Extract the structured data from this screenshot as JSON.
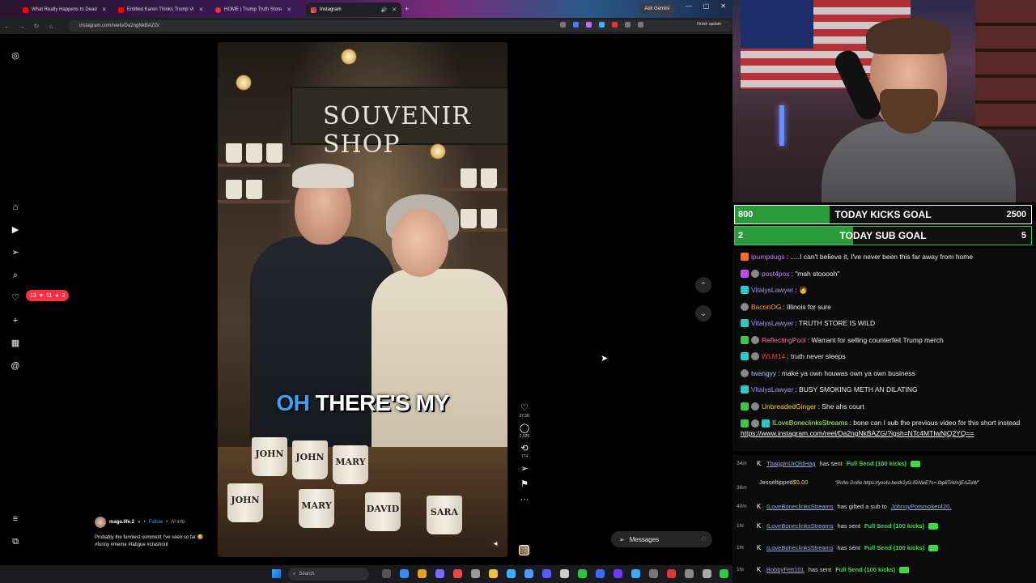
{
  "browser": {
    "tabs": [
      {
        "label": "What Really Happens to Dead",
        "icon": "youtube"
      },
      {
        "label": "Entitled Karen Thinks Trump Vi",
        "icon": "youtube"
      },
      {
        "label": "HOME | Trump Truth Store",
        "icon": "site"
      },
      {
        "label": "Instagram",
        "icon": "instagram"
      }
    ],
    "gemini_label": "Ask Gemini",
    "url": "instagram.com/reels/Da2ngNkBAZG/",
    "finish_update": "Finish update"
  },
  "reel": {
    "sign": "SOUVENIR SHOP",
    "caption_highlight": "OH",
    "caption_rest": " THERE'S MY",
    "mugs": [
      "JOHN",
      "JOHN",
      "MARY",
      "JOHN",
      "MARY",
      "DAVID",
      "SARA"
    ],
    "likes": "37.5K",
    "comments": "2,026",
    "reposts": "774",
    "user": "maga.life.2",
    "follow": "Follow",
    "ai_info": "AI info",
    "description": "Probably the funniest comment I've seen so far 😂 #funny #meme #fatigue #crashout"
  },
  "notifications": {
    "messages": "13",
    "likes": "11",
    "follows": "3"
  },
  "messages_label": "Messages",
  "taskbar": {
    "search_placeholder": "Search"
  },
  "goals": [
    {
      "low": "800",
      "title": "TODAY KICKS GOAL",
      "high": "2500",
      "progress": 0.32
    },
    {
      "low": "2",
      "title": "TODAY SUB GOAL",
      "high": "5",
      "progress": 0.4
    }
  ],
  "chat": [
    {
      "user": "ipumpdugs",
      "color": "#c77dff",
      "text": ": .....I can't believe it, I've never been this far away from home"
    },
    {
      "user": "post4pox",
      "color": "#c77dff",
      "text": ": \"mah stooooh\""
    },
    {
      "user": "VitalysLawyer",
      "color": "#b18cff",
      "text": ": 🧑"
    },
    {
      "user": "BaconOG",
      "color": "#ff9f2e",
      "text": ": Illinois for sure"
    },
    {
      "user": "VitalysLawyer",
      "color": "#b18cff",
      "text": ": TRUTH STORE IS WILD"
    },
    {
      "user": "ReflectingPool",
      "color": "#ff6b9c",
      "text": ": Warrant for selling counterfeit Trump merch"
    },
    {
      "user": "WLM14",
      "color": "#ff3b3b",
      "text": ": truth never sleeps"
    },
    {
      "user": "twangyy",
      "color": "#a8c8ff",
      "text": ": make ya own houwas own ya own business"
    },
    {
      "user": "VitalysLawyer",
      "color": "#b18cff",
      "text": ": BUSY SMOKING METH AN DILATING"
    },
    {
      "user": "UnbreadedGinger",
      "color": "#ffc83a",
      "text": ": She ahs court"
    }
  ],
  "chat_long": {
    "user": "ILoveBoneclinksStreams",
    "color": "#a8ff5a",
    "text": ": bone can I sub the previous video for this short instead ",
    "link": "https://www.instagram.com/reel/Da2ngNkBAZG/?igsh=NTc4MTIwNjQ2YQ=="
  },
  "events": [
    {
      "time": "34m",
      "user": "TbagginUrOldHag",
      "text": "has sent",
      "gift": "Full Send (100 kicks)"
    },
    {
      "time": "36m",
      "user": "Jesseltipped",
      "amount": "$5.00",
      "note": "\"Rollie Dollie",
      "link": "https://youtu.be/dr2yG-fGNwE?s=-tbp8TAtmijEAZaW\""
    },
    {
      "time": "40m",
      "user": "ILoveBoneclinksStreams",
      "text": "has gifted a sub to",
      "target": "JohnnyPotsmoker420."
    },
    {
      "time": "1hr",
      "user": "ILoveBoneclinksStreams",
      "text": "has sent",
      "gift": "Full Send (100 kicks)"
    },
    {
      "time": "1hr",
      "user": "ILoveBoneclinksStreams",
      "text": "has sent",
      "gift": "Full Send (100 kicks)"
    },
    {
      "time": "1hr",
      "user": "BobbyFett101",
      "text": "has sent",
      "gift": "Full Send (100 kicks)"
    }
  ],
  "colors": {
    "accent_blue": "#3aa0ff",
    "goal_green": "#2a9a3a",
    "kick_green": "#3ddc44",
    "ig_red": "#ff3040"
  }
}
